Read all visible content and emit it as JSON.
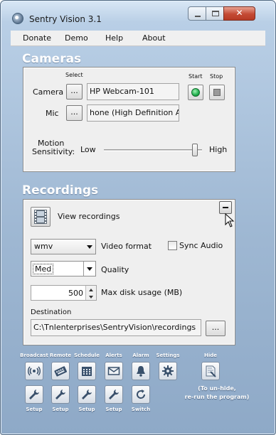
{
  "window": {
    "title": "Sentry Vision 3.1"
  },
  "menu": [
    "Donate",
    "Demo",
    "Help",
    "About"
  ],
  "cameras": {
    "section_title": "Cameras",
    "select_header": "Select",
    "start_header": "Start",
    "stop_header": "Stop",
    "camera_label": "Camera",
    "camera_value": "HP Webcam-101",
    "mic_label": "Mic",
    "mic_value": "hone (High Definition Aud",
    "browse_label": "...",
    "motion_label_line1": "Motion",
    "motion_label_line2": "Sensitivity:",
    "low_label": "Low",
    "high_label": "High",
    "sensitivity_level": 0.93
  },
  "recordings": {
    "section_title": "Recordings",
    "view_recordings": "View recordings",
    "video_format_value": "wmv",
    "video_format_label": "Video format",
    "sync_audio_label": "Sync Audio",
    "sync_audio_checked": false,
    "quality_value": "Med",
    "quality_label": "Quality",
    "max_disk_value": "500",
    "max_disk_label": "Max disk usage (MB)",
    "destination_label": "Destination",
    "destination_value": "C:\\Tnlenterprises\\SentryVision\\recordings",
    "browse_label": "..."
  },
  "toolbar": {
    "top_labels": [
      "Broadcast",
      "Remote",
      "Schedule",
      "Alerts",
      "Alarm",
      "Settings",
      "Hide"
    ],
    "bottom_labels": [
      "Setup",
      "Setup",
      "Setup",
      "Setup",
      "Switch"
    ],
    "hide_note_line1": "(To un-hide,",
    "hide_note_line2": "re-run the program)"
  },
  "icons": {
    "app": "camera-lens-icon",
    "view_recordings": "film-icon",
    "broadcast": "broadcast-icon",
    "remote": "keyboard-icon",
    "schedule": "calendar-icon",
    "alerts": "envelope-icon",
    "alarm": "bell-icon",
    "settings": "gear-icon",
    "hide": "hide-window-icon",
    "setup": "wrench-icon",
    "switch": "refresh-icon"
  },
  "colors": {
    "window_gradient_top": "#d9e7f5",
    "window_gradient_bottom": "#8ea9c7",
    "start_green": "#1fae4c",
    "close_red": "#c44a34"
  }
}
